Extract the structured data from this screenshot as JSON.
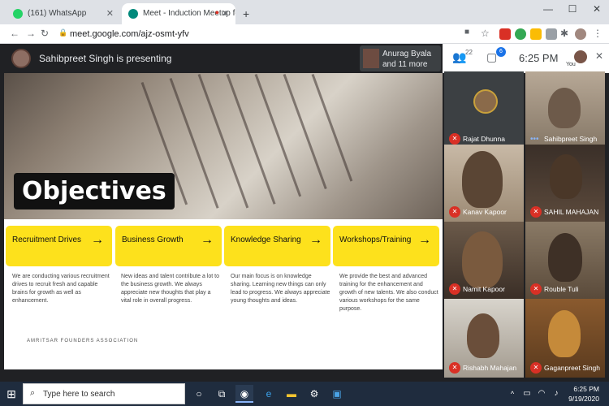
{
  "browser": {
    "tabs": [
      {
        "title": "(161) WhatsApp",
        "color": "#25d366"
      },
      {
        "title": "Meet - Induction Meetup fo",
        "color": "#00897b"
      }
    ],
    "new_tab": "+",
    "url": "meet.google.com/ajz-osmt-yfv"
  },
  "meet": {
    "presenting_text": "Sahibpreet Singh is presenting",
    "pinned": {
      "line1": "Anurag Byala",
      "line2": "and 11 more"
    },
    "participants_count": "22",
    "chat_count": "6",
    "time": "6:25 PM",
    "you_label": "You"
  },
  "slide": {
    "title": "Objectives",
    "cards": [
      {
        "title": "Recruitment Drives",
        "arrow": "→",
        "desc": "We are conducting various recruitment drives to recruit fresh and capable brains for growth as well as enhancement."
      },
      {
        "title": "Business Growth",
        "arrow": "→",
        "desc": "New ideas and talent contribute a lot to the business growth. We always appreciate new thoughts that play a vital role in overall progress."
      },
      {
        "title": "Knowledge Sharing",
        "arrow": "→",
        "desc": "Our main focus is on knowledge sharing. Learning new things can only lead to progress. We always appreciate young thoughts and ideas."
      },
      {
        "title": "Workshops/Training",
        "arrow": "→",
        "desc": "We provide the best and advanced training for the enhancement and growth of new talents. We also conduct various workshops for the same purpose."
      }
    ],
    "footer": "AMRITSAR FOUNDERS ASSOCIATION",
    "accent_color": "#fde11c"
  },
  "participants": [
    {
      "name": "Rajat Dhunna",
      "status": "muted"
    },
    {
      "name": "Sahibpreet Singh",
      "status": "talking"
    },
    {
      "name": "Kanav Kapoor",
      "status": "muted"
    },
    {
      "name": "SAHIL MAHAJAN",
      "status": "muted"
    },
    {
      "name": "Namit Kapoor",
      "status": "muted"
    },
    {
      "name": "Rouble Tuli",
      "status": "muted"
    },
    {
      "name": "Rishabh Mahajan",
      "status": "muted"
    },
    {
      "name": "Gaganpreet Singh",
      "status": "muted"
    }
  ],
  "taskbar": {
    "search_placeholder": "Type here to search",
    "time": "6:25 PM",
    "date": "9/19/2020"
  }
}
